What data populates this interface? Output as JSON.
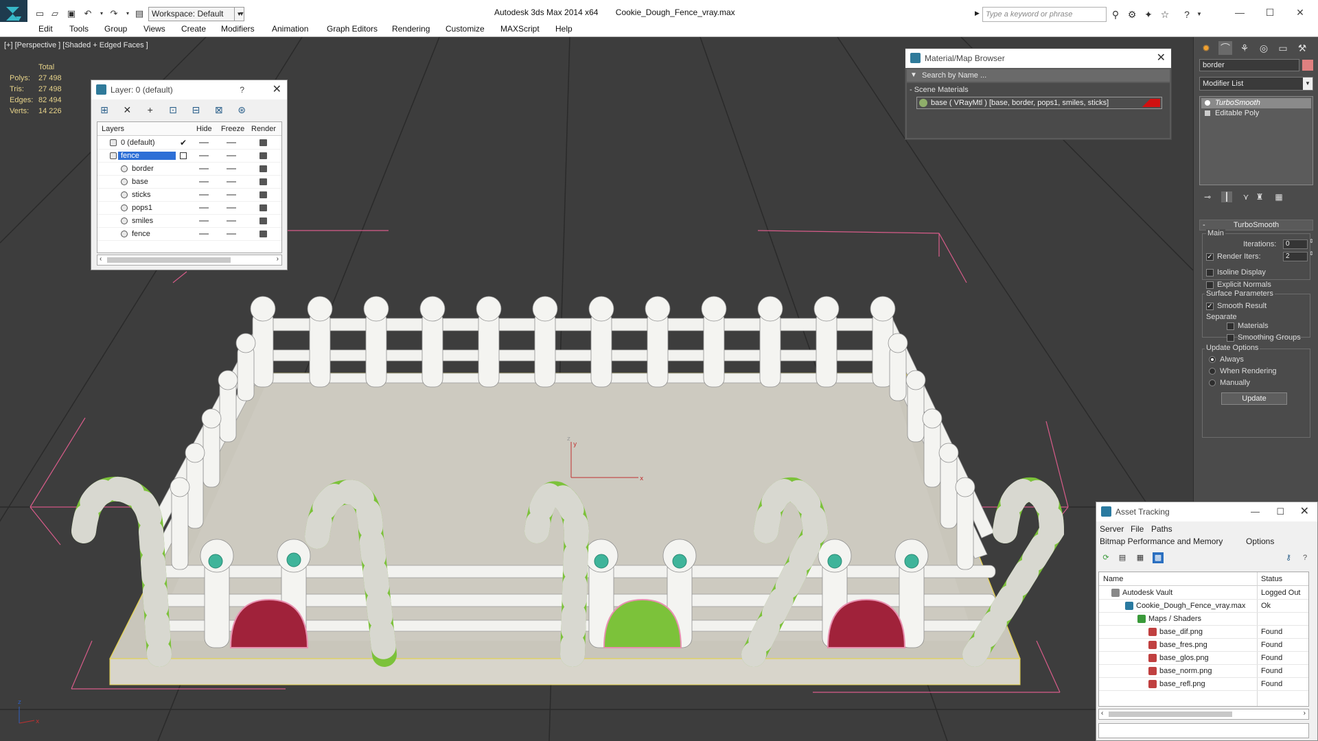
{
  "titlebar": {
    "workspace": "Workspace: Default",
    "app_name": "Autodesk 3ds Max  2014 x64",
    "file_name": "Cookie_Dough_Fence_vray.max",
    "search_placeholder": "Type a keyword or phrase"
  },
  "menu": [
    "Edit",
    "Tools",
    "Group",
    "Views",
    "Create",
    "Modifiers",
    "Animation",
    "Graph Editors",
    "Rendering",
    "Customize",
    "MAXScript",
    "Help"
  ],
  "viewport": {
    "label": "[+] [Perspective ] [Shaded + Edged Faces ]",
    "stats": {
      "header": "Total",
      "rows": [
        {
          "label": "Polys:",
          "value": "27 498"
        },
        {
          "label": "Tris:",
          "value": "27 498"
        },
        {
          "label": "Edges:",
          "value": "82 494"
        },
        {
          "label": "Verts:",
          "value": "14 226"
        }
      ]
    },
    "axis": {
      "x": "x",
      "y": "y",
      "z": "z"
    }
  },
  "layer_dialog": {
    "title": "Layer: 0 (default)",
    "help": "?",
    "columns": {
      "layers": "Layers",
      "hide": "Hide",
      "freeze": "Freeze",
      "render": "Render"
    },
    "rows": [
      "0 (default)",
      "fence",
      "border",
      "base",
      "sticks",
      "pops1",
      "smiles",
      "fence"
    ]
  },
  "material_browser": {
    "title": "Material/Map Browser",
    "search": "Search by Name ...",
    "section": "- Scene Materials",
    "item": "base ( VRayMtl ) [base, border, pops1, smiles, sticks]"
  },
  "command_panel": {
    "object_name": "border",
    "modifier_list": "Modifier List",
    "stack": [
      "TurboSmooth",
      "Editable Poly"
    ],
    "rollout": "TurboSmooth",
    "main": "Main",
    "iterations_label": "Iterations:",
    "iterations_value": "0",
    "render_iters_label": "Render Iters:",
    "render_iters_value": "2",
    "isoline": "Isoline Display",
    "explicit_normals": "Explicit Normals",
    "surface_params": "Surface Parameters",
    "smooth_result": "Smooth Result",
    "separate": "Separate",
    "materials": "Materials",
    "smoothing_groups": "Smoothing Groups",
    "update_options": "Update Options",
    "always": "Always",
    "when_rendering": "When Rendering",
    "manually": "Manually",
    "update_button": "Update"
  },
  "asset_tracking": {
    "title": "Asset Tracking",
    "menu_row1": [
      "Server",
      "File",
      "Paths"
    ],
    "menu_row2": [
      "Bitmap Performance and Memory",
      "Options"
    ],
    "columns": {
      "name": "Name",
      "status": "Status"
    },
    "rows": [
      {
        "name": "Autodesk Vault",
        "status": "Logged Out"
      },
      {
        "name": "Cookie_Dough_Fence_vray.max",
        "status": "Ok"
      },
      {
        "name": "Maps / Shaders",
        "status": ""
      },
      {
        "name": "base_dif.png",
        "status": "Found"
      },
      {
        "name": "base_fres.png",
        "status": "Found"
      },
      {
        "name": "base_glos.png",
        "status": "Found"
      },
      {
        "name": "base_norm.png",
        "status": "Found"
      },
      {
        "name": "base_refl.png",
        "status": "Found"
      }
    ]
  },
  "colors": {
    "viewport_bg": "#3d3d3d",
    "selection_blue": "#2d6fd6",
    "candy_green": "#7cc23a",
    "fence_white": "#efefef",
    "selection_box": "#e06090"
  }
}
